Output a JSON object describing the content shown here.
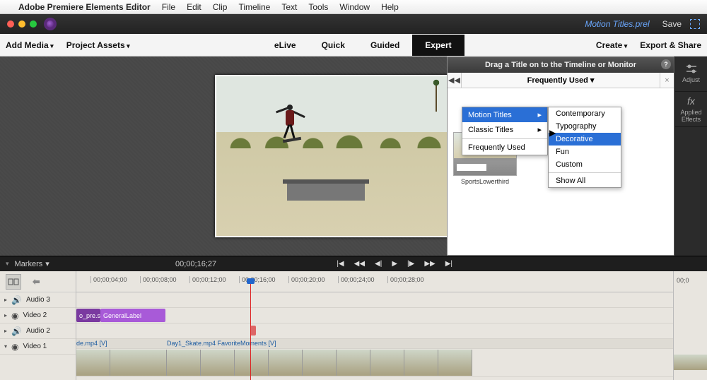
{
  "menubar": {
    "app_name": "Adobe Premiere Elements Editor",
    "items": [
      "File",
      "Edit",
      "Clip",
      "Timeline",
      "Text",
      "Tools",
      "Window",
      "Help"
    ]
  },
  "titlebar": {
    "project_name": "Motion Titles.prel",
    "save_label": "Save"
  },
  "toolbar": {
    "add_media": "Add Media",
    "project_assets": "Project Assets",
    "tabs": [
      "eLive",
      "Quick",
      "Guided",
      "Expert"
    ],
    "active_tab": "Expert",
    "create": "Create",
    "export_share": "Export & Share"
  },
  "right_sidebar": {
    "adjust": "Adjust",
    "applied_effects": "Applied\nEffects"
  },
  "titles_panel": {
    "header": "Drag a Title on to the Timeline or Monitor",
    "breadcrumb": "Frequently Used",
    "thumb_caption": "SportsLowerthird",
    "flyout1": {
      "items": [
        "Motion Titles",
        "Classic Titles",
        "Frequently Used"
      ],
      "selected": "Motion Titles"
    },
    "flyout2": {
      "items": [
        "Contemporary",
        "Typography",
        "Decorative",
        "Fun",
        "Custom",
        "Show All"
      ],
      "selected": "Decorative"
    }
  },
  "transport": {
    "markers_label": "Markers",
    "timecode": "00;00;16;27"
  },
  "timeline": {
    "ruler": [
      "00;00;04;00",
      "00;00;08;00",
      "00;00;12;00",
      "00;00;16;00",
      "00;00;20;00",
      "00;00;24;00",
      "00;00;28;00"
    ],
    "ruler_right": "00;0",
    "tracks": {
      "audio3": "Audio 3",
      "video2": "Video 2",
      "audio2": "Audio 2",
      "video1": "Video 1"
    },
    "clips": {
      "v2a": "o_pre.s",
      "v2b": "GeneralLabel",
      "v1a": "de.mp4 [V]",
      "v1b": "Day1_Skate.mp4 FavoriteMoments [V]"
    }
  }
}
